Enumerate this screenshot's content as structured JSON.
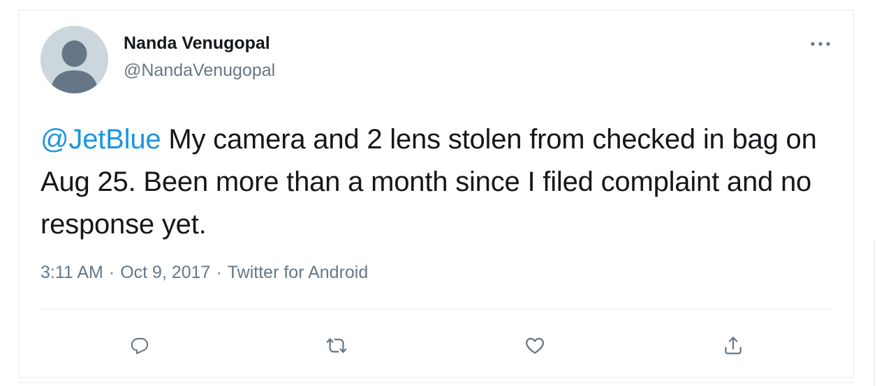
{
  "author": {
    "name": "Nanda Venugopal",
    "handle": "@NandaVenugopal"
  },
  "tweet": {
    "mention": "@JetBlue",
    "text": " My camera and 2 lens stolen from checked in bag on Aug 25. Been more than a month since I filed complaint and no response yet."
  },
  "meta": {
    "time": "3:11 AM",
    "date": "Oct 9, 2017",
    "source": "Twitter for Android",
    "separator": "·"
  },
  "icons": {
    "more": "more-horizontal-icon",
    "reply": "reply-icon",
    "retweet": "retweet-icon",
    "like": "like-icon",
    "share": "share-icon"
  },
  "colors": {
    "link": "#1b95e0",
    "text": "#14171a",
    "secondary": "#657786",
    "border": "#e6ecf0",
    "avatar_bg": "#ccd6dd",
    "avatar_fg": "#657786"
  }
}
